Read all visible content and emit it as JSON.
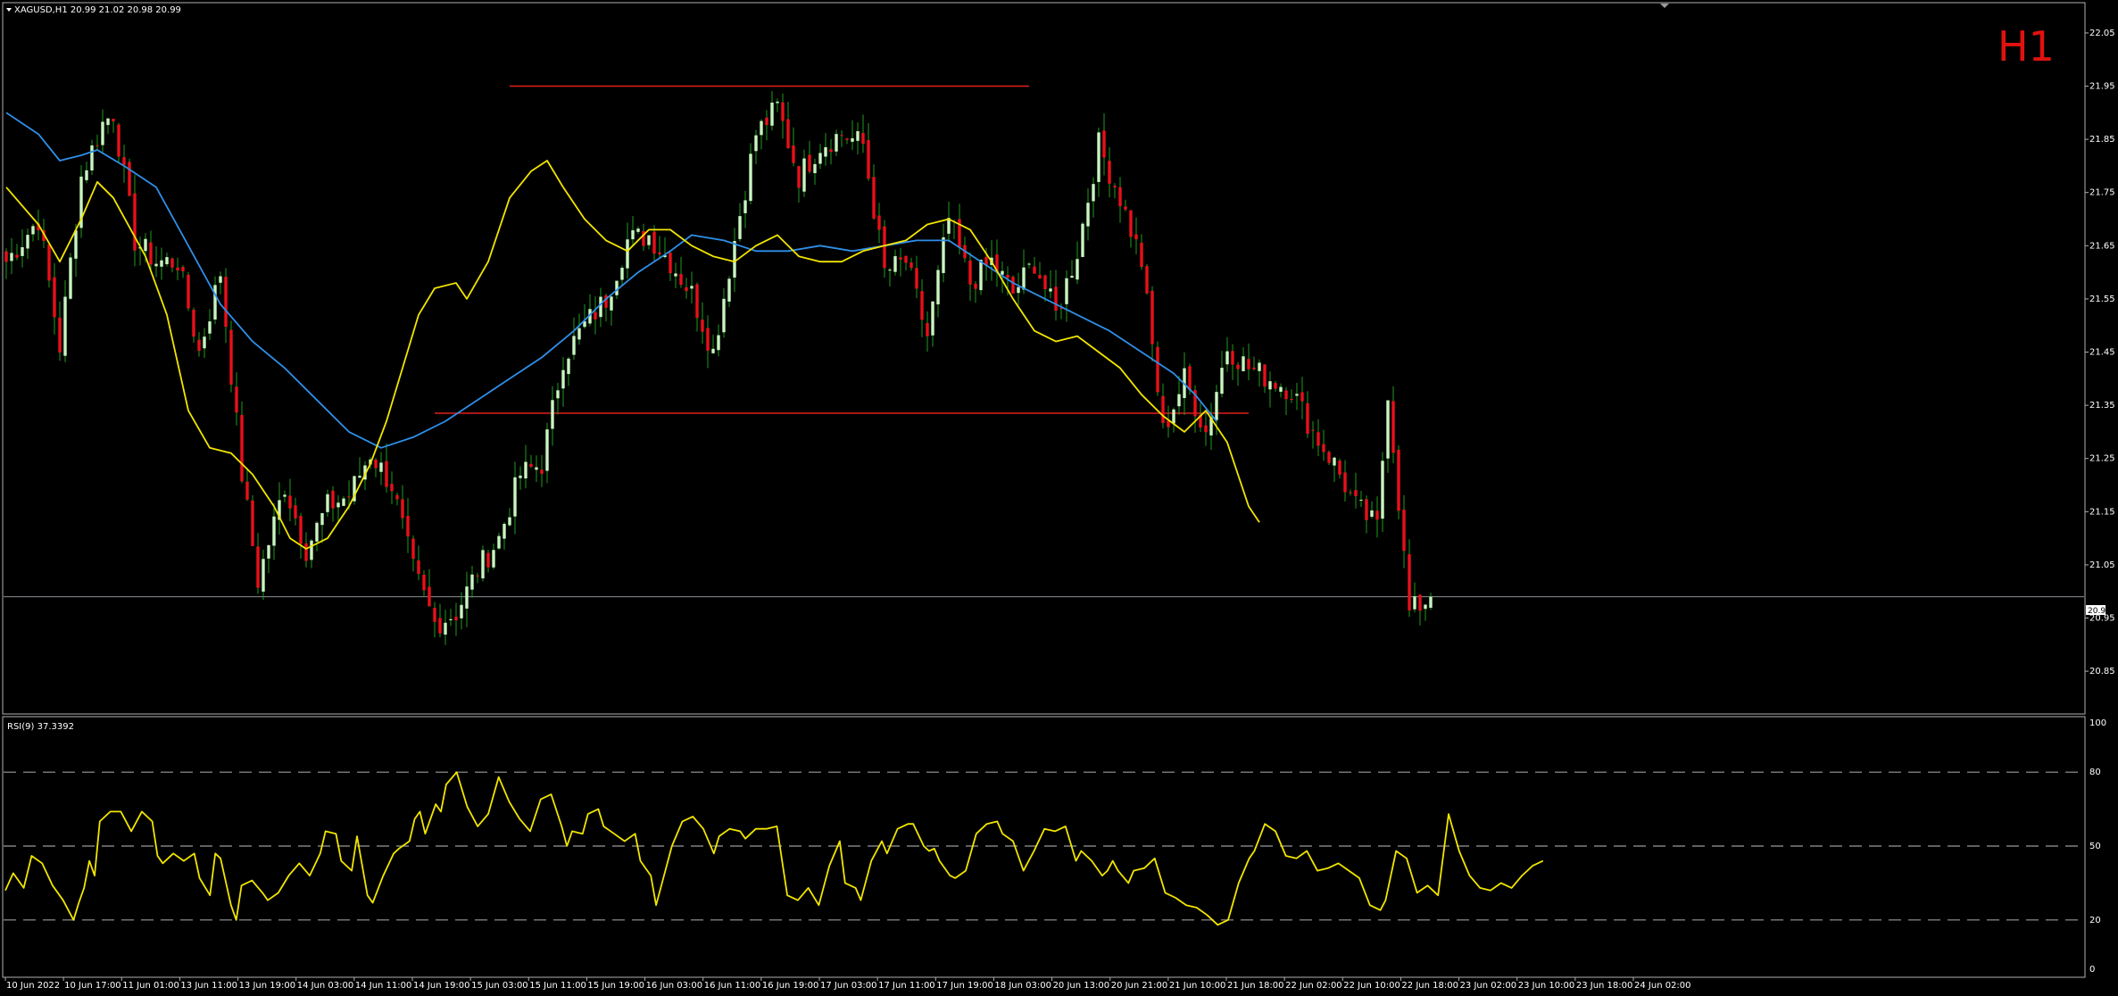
{
  "header": {
    "symbol_line": "XAGUSD,H1  20.99 21.02 20.98 20.99",
    "timeframe": "H1",
    "rsi_label": "RSI(9) 37.3392"
  },
  "colors": {
    "background": "#000000",
    "bull_candle": "#c8f5c0",
    "bear_candle": "#e8101a",
    "wick": "#1f9a1f",
    "ma_fast": "#f2e500",
    "ma_slow": "#2f8fe8",
    "level_line": "#e0201c",
    "rsi_line": "#f2e500",
    "grid_dash": "#9a9a9a",
    "frame": "#b0b0b0"
  },
  "current_price_label": "20.99",
  "chart_data": [
    {
      "type": "candlestick",
      "name": "price",
      "ylim": [
        20.82,
        22.07
      ],
      "price_ticks": [
        "22.05",
        "21.95",
        "21.85",
        "21.75",
        "21.65",
        "21.55",
        "21.45",
        "21.35",
        "21.25",
        "21.15",
        "21.05",
        "20.95",
        "20.85"
      ],
      "x_tick_labels": [
        "10 Jun 2022",
        "10 Jun 17:00",
        "11 Jun 01:00",
        "13 Jun 11:00",
        "13 Jun 19:00",
        "14 Jun 03:00",
        "14 Jun 11:00",
        "14 Jun 19:00",
        "15 Jun 03:00",
        "15 Jun 11:00",
        "15 Jun 19:00",
        "16 Jun 03:00",
        "16 Jun 11:00",
        "16 Jun 19:00",
        "17 Jun 03:00",
        "17 Jun 11:00",
        "17 Jun 19:00",
        "18 Jun 03:00",
        "20 Jun 13:00",
        "20 Jun 21:00",
        "21 Jun 10:00",
        "21 Jun 18:00",
        "22 Jun 02:00",
        "22 Jun 10:00",
        "22 Jun 18:00",
        "23 Jun 02:00",
        "23 Jun 10:00",
        "23 Jun 18:00",
        "24 Jun 02:00"
      ],
      "anchors_close": [
        [
          0,
          21.62
        ],
        [
          6,
          21.7
        ],
        [
          10,
          21.46
        ],
        [
          14,
          21.78
        ],
        [
          18,
          21.88
        ],
        [
          20,
          21.9
        ],
        [
          24,
          21.66
        ],
        [
          28,
          21.62
        ],
        [
          32,
          21.62
        ],
        [
          36,
          21.45
        ],
        [
          40,
          21.6
        ],
        [
          44,
          21.22
        ],
        [
          47,
          21.02
        ],
        [
          52,
          21.2
        ],
        [
          56,
          21.08
        ],
        [
          60,
          21.16
        ],
        [
          64,
          21.18
        ],
        [
          68,
          21.26
        ],
        [
          72,
          21.2
        ],
        [
          76,
          21.04
        ],
        [
          80,
          20.94
        ],
        [
          84,
          20.96
        ],
        [
          88,
          21.04
        ],
        [
          92,
          21.1
        ],
        [
          96,
          21.22
        ],
        [
          100,
          21.24
        ],
        [
          104,
          21.44
        ],
        [
          108,
          21.5
        ],
        [
          112,
          21.55
        ],
        [
          116,
          21.66
        ],
        [
          120,
          21.67
        ],
        [
          124,
          21.62
        ],
        [
          128,
          21.56
        ],
        [
          132,
          21.45
        ],
        [
          136,
          21.66
        ],
        [
          140,
          21.86
        ],
        [
          144,
          21.91
        ],
        [
          148,
          21.78
        ],
        [
          152,
          21.84
        ],
        [
          156,
          21.86
        ],
        [
          160,
          21.84
        ],
        [
          164,
          21.6
        ],
        [
          168,
          21.62
        ],
        [
          172,
          21.48
        ],
        [
          176,
          21.7
        ],
        [
          180,
          21.58
        ],
        [
          184,
          21.62
        ],
        [
          188,
          21.56
        ],
        [
          192,
          21.62
        ],
        [
          196,
          21.52
        ],
        [
          200,
          21.64
        ],
        [
          204,
          21.84
        ],
        [
          208,
          21.74
        ],
        [
          212,
          21.62
        ],
        [
          216,
          21.3
        ],
        [
          220,
          21.4
        ],
        [
          224,
          21.3
        ],
        [
          228,
          21.46
        ],
        [
          232,
          21.42
        ],
        [
          236,
          21.4
        ],
        [
          240,
          21.38
        ],
        [
          244,
          21.3
        ],
        [
          248,
          21.24
        ],
        [
          252,
          21.16
        ],
        [
          256,
          21.12
        ],
        [
          258,
          21.38
        ],
        [
          262,
          20.96
        ],
        [
          266,
          20.99
        ]
      ],
      "ma_fast_points": [
        [
          0,
          21.76
        ],
        [
          6,
          21.69
        ],
        [
          10,
          21.62
        ],
        [
          14,
          21.7
        ],
        [
          17,
          21.77
        ],
        [
          20,
          21.74
        ],
        [
          26,
          21.63
        ],
        [
          30,
          21.52
        ],
        [
          34,
          21.34
        ],
        [
          38,
          21.27
        ],
        [
          42,
          21.26
        ],
        [
          46,
          21.22
        ],
        [
          50,
          21.16
        ],
        [
          53,
          21.1
        ],
        [
          56,
          21.08
        ],
        [
          60,
          21.1
        ],
        [
          64,
          21.16
        ],
        [
          68,
          21.24
        ],
        [
          71,
          21.32
        ],
        [
          74,
          21.42
        ],
        [
          77,
          21.52
        ],
        [
          80,
          21.57
        ],
        [
          84,
          21.58
        ],
        [
          86,
          21.55
        ],
        [
          90,
          21.62
        ],
        [
          94,
          21.74
        ],
        [
          98,
          21.79
        ],
        [
          101,
          21.81
        ],
        [
          104,
          21.76
        ],
        [
          108,
          21.7
        ],
        [
          112,
          21.66
        ],
        [
          116,
          21.64
        ],
        [
          120,
          21.68
        ],
        [
          124,
          21.68
        ],
        [
          128,
          21.65
        ],
        [
          132,
          21.63
        ],
        [
          136,
          21.62
        ],
        [
          140,
          21.65
        ],
        [
          144,
          21.67
        ],
        [
          148,
          21.63
        ],
        [
          152,
          21.62
        ],
        [
          156,
          21.62
        ],
        [
          160,
          21.64
        ],
        [
          164,
          21.65
        ],
        [
          168,
          21.66
        ],
        [
          172,
          21.69
        ],
        [
          176,
          21.7
        ],
        [
          180,
          21.68
        ],
        [
          184,
          21.62
        ],
        [
          188,
          21.55
        ],
        [
          192,
          21.49
        ],
        [
          196,
          21.47
        ],
        [
          200,
          21.48
        ],
        [
          204,
          21.45
        ],
        [
          208,
          21.42
        ],
        [
          212,
          21.37
        ],
        [
          216,
          21.33
        ],
        [
          220,
          21.3
        ],
        [
          224,
          21.34
        ],
        [
          228,
          21.28
        ],
        [
          232,
          21.16
        ],
        [
          234,
          21.13
        ]
      ],
      "ma_slow_points": [
        [
          0,
          21.9
        ],
        [
          6,
          21.86
        ],
        [
          10,
          21.81
        ],
        [
          14,
          21.82
        ],
        [
          17,
          21.83
        ],
        [
          22,
          21.8
        ],
        [
          28,
          21.76
        ],
        [
          34,
          21.65
        ],
        [
          40,
          21.54
        ],
        [
          46,
          21.47
        ],
        [
          52,
          21.42
        ],
        [
          58,
          21.36
        ],
        [
          64,
          21.3
        ],
        [
          70,
          21.27
        ],
        [
          76,
          21.29
        ],
        [
          82,
          21.32
        ],
        [
          88,
          21.36
        ],
        [
          94,
          21.4
        ],
        [
          100,
          21.44
        ],
        [
          106,
          21.49
        ],
        [
          112,
          21.55
        ],
        [
          118,
          21.6
        ],
        [
          124,
          21.64
        ],
        [
          128,
          21.67
        ],
        [
          134,
          21.66
        ],
        [
          140,
          21.64
        ],
        [
          146,
          21.64
        ],
        [
          152,
          21.65
        ],
        [
          158,
          21.64
        ],
        [
          164,
          21.65
        ],
        [
          170,
          21.66
        ],
        [
          176,
          21.66
        ],
        [
          182,
          21.62
        ],
        [
          188,
          21.58
        ],
        [
          194,
          21.55
        ],
        [
          200,
          21.52
        ],
        [
          206,
          21.49
        ],
        [
          212,
          21.45
        ],
        [
          218,
          21.41
        ],
        [
          222,
          21.37
        ],
        [
          226,
          21.32
        ]
      ],
      "levels": [
        {
          "value": 21.95,
          "from_bar": 94,
          "to_bar": 191
        },
        {
          "value": 21.335,
          "from_bar": 80,
          "to_bar": 232
        }
      ],
      "current_price": 20.99
    },
    {
      "type": "line",
      "name": "RSI(9)",
      "ylim": [
        0,
        100
      ],
      "y_ticks": [
        "100",
        "80",
        "50",
        "20",
        "0"
      ],
      "reference_levels": [
        80,
        50,
        20
      ],
      "points": [
        [
          0,
          32
        ],
        [
          3,
          39
        ],
        [
          7,
          33
        ],
        [
          10,
          46
        ],
        [
          14,
          43
        ],
        [
          18,
          34
        ],
        [
          22,
          28
        ],
        [
          26,
          20
        ],
        [
          28,
          27
        ],
        [
          30,
          33
        ],
        [
          32,
          44
        ],
        [
          34,
          38
        ],
        [
          36,
          60
        ],
        [
          40,
          64
        ],
        [
          44,
          64
        ],
        [
          48,
          56
        ],
        [
          52,
          64
        ],
        [
          56,
          60
        ],
        [
          58,
          46
        ],
        [
          60,
          43
        ],
        [
          64,
          47
        ],
        [
          68,
          44
        ],
        [
          72,
          47
        ],
        [
          74,
          37
        ],
        [
          78,
          30
        ],
        [
          80,
          47
        ],
        [
          82,
          45
        ],
        [
          86,
          26
        ],
        [
          88,
          20
        ],
        [
          90,
          34
        ],
        [
          94,
          36
        ],
        [
          98,
          31
        ],
        [
          100,
          28
        ],
        [
          104,
          31
        ],
        [
          108,
          38
        ],
        [
          112,
          43
        ],
        [
          116,
          38
        ],
        [
          120,
          47
        ],
        [
          122,
          56
        ],
        [
          126,
          55
        ],
        [
          128,
          44
        ],
        [
          132,
          40
        ],
        [
          134,
          54
        ],
        [
          138,
          30
        ],
        [
          140,
          27
        ],
        [
          144,
          38
        ],
        [
          148,
          47
        ],
        [
          150,
          49
        ],
        [
          154,
          52
        ],
        [
          156,
          61
        ],
        [
          158,
          64
        ],
        [
          160,
          55
        ],
        [
          164,
          67
        ],
        [
          166,
          64
        ],
        [
          168,
          75
        ],
        [
          172,
          80
        ],
        [
          176,
          66
        ],
        [
          180,
          58
        ],
        [
          184,
          63
        ],
        [
          188,
          78
        ],
        [
          192,
          68
        ],
        [
          196,
          61
        ],
        [
          200,
          56
        ],
        [
          204,
          69
        ],
        [
          208,
          71
        ],
        [
          212,
          58
        ],
        [
          214,
          50
        ],
        [
          216,
          56
        ],
        [
          220,
          55
        ],
        [
          222,
          63
        ],
        [
          226,
          65
        ],
        [
          228,
          58
        ],
        [
          232,
          55
        ],
        [
          236,
          52
        ],
        [
          240,
          55
        ],
        [
          242,
          44
        ],
        [
          246,
          38
        ],
        [
          248,
          26
        ],
        [
          250,
          34
        ],
        [
          254,
          50
        ],
        [
          258,
          60
        ],
        [
          262,
          62
        ],
        [
          266,
          57
        ],
        [
          270,
          47
        ],
        [
          272,
          54
        ],
        [
          276,
          57
        ],
        [
          280,
          56
        ],
        [
          282,
          53
        ],
        [
          286,
          57
        ],
        [
          290,
          57
        ],
        [
          294,
          58
        ],
        [
          298,
          30
        ],
        [
          302,
          28
        ],
        [
          306,
          33
        ],
        [
          310,
          26
        ],
        [
          314,
          42
        ],
        [
          318,
          52
        ],
        [
          320,
          35
        ],
        [
          324,
          33
        ],
        [
          326,
          28
        ],
        [
          330,
          44
        ],
        [
          334,
          52
        ],
        [
          336,
          47
        ],
        [
          340,
          57
        ],
        [
          344,
          59
        ],
        [
          346,
          59
        ],
        [
          350,
          50
        ],
        [
          352,
          48
        ],
        [
          354,
          49
        ],
        [
          356,
          44
        ],
        [
          360,
          38
        ],
        [
          362,
          37
        ],
        [
          366,
          40
        ],
        [
          370,
          55
        ],
        [
          374,
          59
        ],
        [
          378,
          60
        ],
        [
          380,
          55
        ],
        [
          384,
          52
        ],
        [
          388,
          40
        ],
        [
          392,
          48
        ],
        [
          396,
          57
        ],
        [
          400,
          56
        ],
        [
          404,
          58
        ],
        [
          408,
          44
        ],
        [
          410,
          48
        ],
        [
          414,
          44
        ],
        [
          418,
          38
        ],
        [
          420,
          40
        ],
        [
          422,
          44
        ],
        [
          424,
          40
        ],
        [
          428,
          35
        ],
        [
          430,
          40
        ],
        [
          434,
          41
        ],
        [
          438,
          45
        ],
        [
          442,
          31
        ],
        [
          446,
          29
        ],
        [
          450,
          26
        ],
        [
          454,
          25
        ],
        [
          458,
          22
        ],
        [
          462,
          18
        ],
        [
          466,
          20
        ],
        [
          470,
          35
        ],
        [
          474,
          45
        ],
        [
          476,
          48
        ],
        [
          480,
          59
        ],
        [
          484,
          56
        ],
        [
          488,
          46
        ],
        [
          492,
          45
        ],
        [
          496,
          48
        ],
        [
          500,
          40
        ],
        [
          504,
          41
        ],
        [
          508,
          43
        ],
        [
          512,
          40
        ],
        [
          516,
          37
        ],
        [
          520,
          26
        ],
        [
          524,
          24
        ],
        [
          526,
          28
        ],
        [
          530,
          48
        ],
        [
          534,
          45
        ],
        [
          538,
          31
        ],
        [
          542,
          34
        ],
        [
          546,
          30
        ],
        [
          550,
          63
        ],
        [
          554,
          48
        ],
        [
          558,
          38
        ],
        [
          562,
          33
        ],
        [
          566,
          32
        ],
        [
          570,
          35
        ],
        [
          574,
          33
        ],
        [
          578,
          38
        ],
        [
          582,
          42
        ],
        [
          586,
          44
        ]
      ],
      "current_value": 37.3392
    }
  ]
}
